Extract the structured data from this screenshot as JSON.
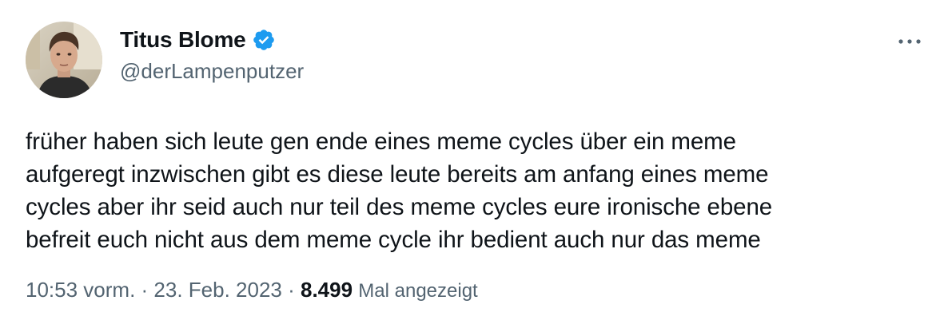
{
  "author": {
    "display_name": "Titus Blome",
    "handle": "@derLampenputzer",
    "verified": true,
    "verified_color": "#1d9bf0"
  },
  "tweet": {
    "text": "früher haben sich leute gen ende eines meme cycles über ein meme\naufgeregt inzwischen gibt es diese leute bereits am anfang eines meme\ncycles aber ihr seid auch nur teil des meme cycles eure ironische ebene\nbefreit euch nicht aus dem meme cycle ihr bedient auch nur das meme"
  },
  "meta": {
    "time": "10:53 vorm.",
    "separator": " · ",
    "date": "23. Feb. 2023",
    "views_count": "8.499",
    "views_label": "Mal angezeigt"
  },
  "icons": {
    "more": "more-options-icon",
    "verified": "verified-badge-icon"
  }
}
